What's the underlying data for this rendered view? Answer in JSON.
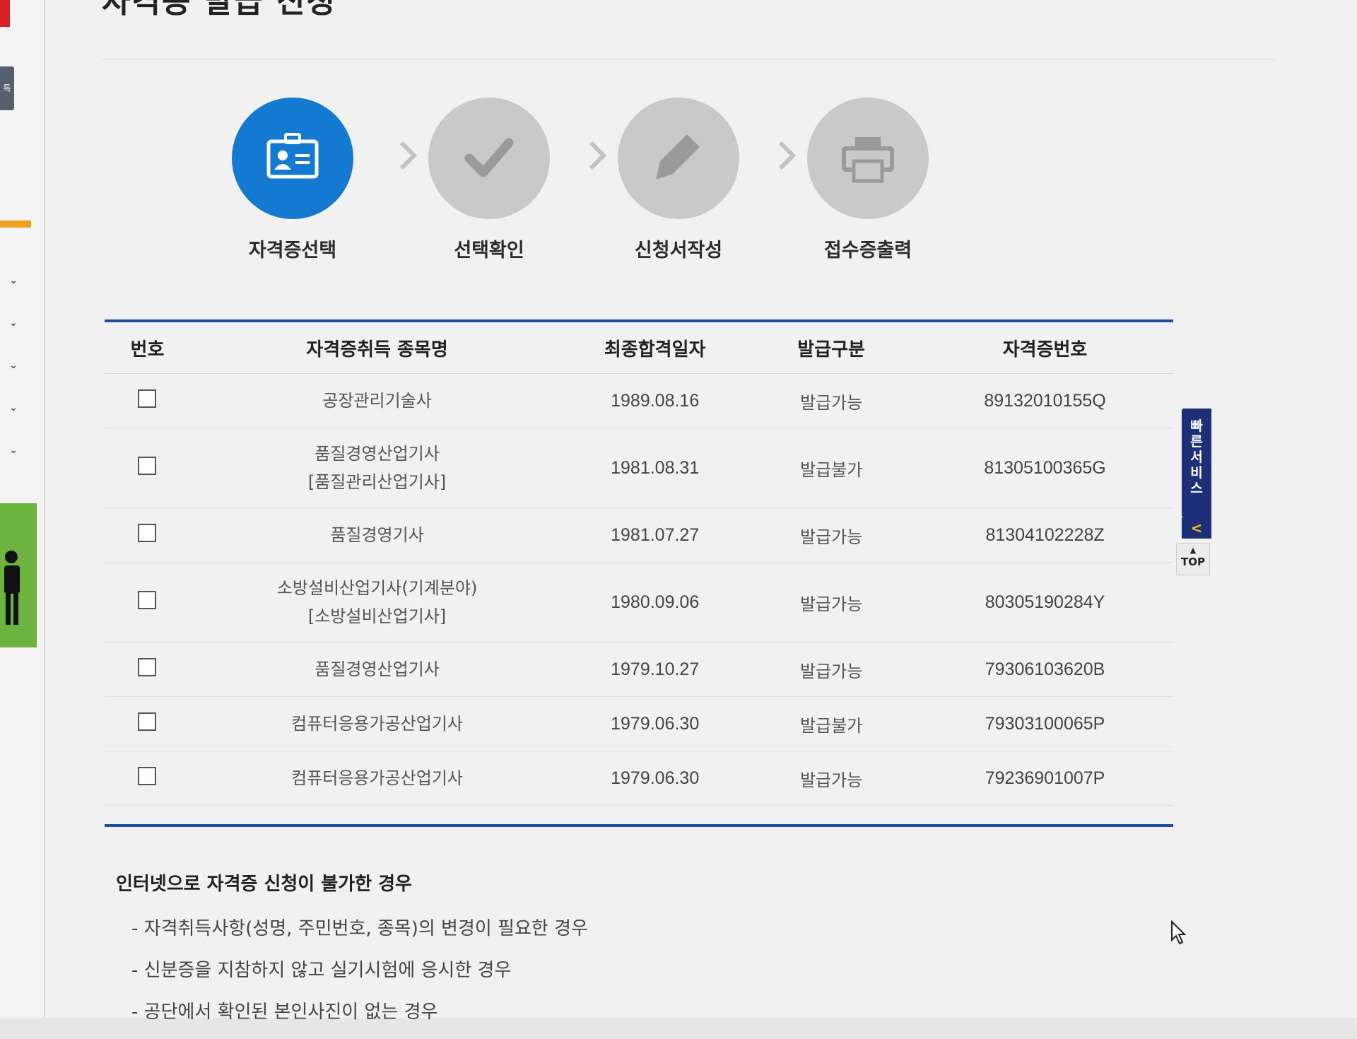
{
  "sidebar": {
    "tab_char": "특",
    "chevrons": [
      "⌄",
      "⌄",
      "⌄",
      "⌄",
      "⌄"
    ]
  },
  "page": {
    "title": "자격증 발급 신청"
  },
  "steps": [
    {
      "label": "자격증선택",
      "icon": "id-card-icon",
      "active": true
    },
    {
      "label": "선택확인",
      "icon": "check-icon",
      "active": false
    },
    {
      "label": "신청서작성",
      "icon": "pencil-icon",
      "active": false
    },
    {
      "label": "접수증출력",
      "icon": "printer-icon",
      "active": false
    }
  ],
  "table": {
    "headers": [
      "번호",
      "자격증취득 종목명",
      "최종합격일자",
      "발급구분",
      "자격증번호"
    ],
    "rows": [
      {
        "name": "공장관리기술사",
        "name2": "",
        "date": "1989.08.16",
        "status": "발급가능",
        "number": "89132010155Q"
      },
      {
        "name": "품질경영산업기사",
        "name2": "[품질관리산업기사]",
        "date": "1981.08.31",
        "status": "발급불가",
        "number": "81305100365G"
      },
      {
        "name": "품질경영기사",
        "name2": "",
        "date": "1981.07.27",
        "status": "발급가능",
        "number": "81304102228Z"
      },
      {
        "name": "소방설비산업기사(기계분야)",
        "name2": "[소방설비산업기사]",
        "date": "1980.09.06",
        "status": "발급가능",
        "number": "80305190284Y"
      },
      {
        "name": "품질경영산업기사",
        "name2": "",
        "date": "1979.10.27",
        "status": "발급가능",
        "number": "79306103620B"
      },
      {
        "name": "컴퓨터응용가공산업기사",
        "name2": "",
        "date": "1979.06.30",
        "status": "발급불가",
        "number": "79303100065P"
      },
      {
        "name": "컴퓨터응용가공산업기사",
        "name2": "",
        "date": "1979.06.30",
        "status": "발급가능",
        "number": "79236901007P"
      }
    ]
  },
  "notes": {
    "title": "인터넷으로 자격증 신청이 불가한 경우",
    "items": [
      "- 자격취득사항(성명, 주민번호, 종목)의 변경이 필요한 경우",
      "- 신분증을 지참하지 않고 실기시험에 응시한 경우",
      "- 공단에서 확인된 본인사진이 없는 경우"
    ]
  },
  "quick_service": {
    "label": "빠른서비스",
    "collapse": "<",
    "top_label": "TOP"
  },
  "colors": {
    "accent": "#1479d1",
    "table_border": "#1c4fa0",
    "quick_bg": "#1e2f7a",
    "inactive_step": "#c9c9c9"
  }
}
